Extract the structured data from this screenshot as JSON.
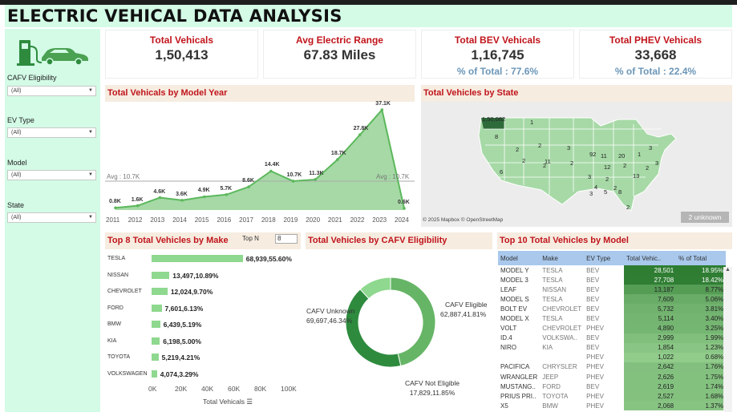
{
  "title": "ELECTRIC VEHICAL DATA ANALYSIS",
  "filters": [
    {
      "label": "CAFV Eligibility",
      "value": "(All)"
    },
    {
      "label": "EV Type",
      "value": "(All)"
    },
    {
      "label": "Model",
      "value": "(All)"
    },
    {
      "label": "State",
      "value": "(All)"
    }
  ],
  "kpis": {
    "total": {
      "title": "Total Vehicals",
      "value": "1,50,413"
    },
    "range": {
      "title": "Avg Electric Range",
      "value": "67.83 Miles"
    },
    "bev": {
      "title": "Total BEV Vehicals",
      "value": "1,16,745",
      "pct": "% of Total : 77.6%"
    },
    "phev": {
      "title": "Total PHEV Vehicals",
      "value": "33,668",
      "pct": "% of Total : 22.4%"
    }
  },
  "year_panel": {
    "title": "Total Vehicals by Model Year",
    "avg_left": "Avg : 10.7K",
    "avg_right": "Avg : 10.7K"
  },
  "state_panel": {
    "title": "Total Vehicles by State",
    "top_value": "1,50,082",
    "credit": "© 2025 Mapbox © OpenStreetMap",
    "unknown": "2 unknown"
  },
  "make_panel": {
    "title": "Top 8 Total Vehicles by Make",
    "topn_label": "Top N",
    "topn_value": "8",
    "xlabel": "Total Vehicals"
  },
  "cafv_panel": {
    "title": "Total Vehicles by CAFV Eligibility",
    "labels": [
      {
        "name": "CAFV Unknown",
        "value": "69,697,46.34%"
      },
      {
        "name": "CAFV Eligible",
        "value": "62,887,41.81%"
      },
      {
        "name": "CAFV Not Eligible",
        "value": "17,829,11.85%"
      }
    ]
  },
  "model_panel": {
    "title": "Top 10 Total Vehicles by Model",
    "headers": [
      "Model",
      "Make",
      "EV Type",
      "Total Vehic..",
      "% of Total"
    ],
    "rows": [
      [
        "MODEL Y",
        "TESLA",
        "BEV",
        "28,501",
        "18.95%"
      ],
      [
        "MODEL 3",
        "TESLA",
        "BEV",
        "27,708",
        "18.42%"
      ],
      [
        "LEAF",
        "NISSAN",
        "BEV",
        "13,187",
        "8.77%"
      ],
      [
        "MODEL S",
        "TESLA",
        "BEV",
        "7,609",
        "5.06%"
      ],
      [
        "BOLT EV",
        "CHEVROLET",
        "BEV",
        "5,732",
        "3.81%"
      ],
      [
        "MODEL X",
        "TESLA",
        "BEV",
        "5,114",
        "3.40%"
      ],
      [
        "VOLT",
        "CHEVROLET",
        "PHEV",
        "4,890",
        "3.25%"
      ],
      [
        "ID.4",
        "VOLKSWA..",
        "BEV",
        "2,999",
        "1.99%"
      ],
      [
        "NIRO",
        "KIA",
        "BEV",
        "1,854",
        "1.23%"
      ],
      [
        "",
        "",
        "PHEV",
        "1,022",
        "0.68%"
      ],
      [
        "PACIFICA",
        "CHRYSLER",
        "PHEV",
        "2,642",
        "1.76%"
      ],
      [
        "WRANGLER",
        "JEEP",
        "PHEV",
        "2,626",
        "1.75%"
      ],
      [
        "MUSTANG..",
        "FORD",
        "BEV",
        "2,619",
        "1.74%"
      ],
      [
        "PRIUS PRI..",
        "TOYOTA",
        "PHEV",
        "2,527",
        "1.68%"
      ],
      [
        "X5",
        "BMW",
        "PHEV",
        "2,068",
        "1.37%"
      ]
    ]
  },
  "colors": {
    "accent_red": "#c0141b",
    "green_dark": "#2e8b3e",
    "green_light": "#8fd88f",
    "header_bg": "#d3fbe6",
    "blue_pct": "#6b96b8"
  },
  "chart_data": [
    {
      "type": "area",
      "title": "Total Vehicals by Model Year",
      "categories": [
        "2011",
        "2012",
        "2013",
        "2014",
        "2015",
        "2016",
        "2017",
        "2018",
        "2019",
        "2020",
        "2021",
        "2022",
        "2023",
        "2024"
      ],
      "values": [
        0.8,
        1.6,
        4.6,
        3.6,
        4.9,
        5.7,
        8.6,
        14.4,
        10.7,
        11.3,
        18.7,
        27.8,
        37.1,
        0.6
      ],
      "labels": [
        "0.8K",
        "1.6K",
        "4.6K",
        "3.6K",
        "4.9K",
        "5.7K",
        "8.6K",
        "14.4K",
        "10.7K",
        "11.3K",
        "18.7K",
        "27.8K",
        "37.1K",
        "0.6K"
      ],
      "unit": "K",
      "reference_line": 10.7,
      "ylim": [
        0,
        38
      ]
    },
    {
      "type": "bar",
      "title": "Top 8 Total Vehicles by Make",
      "categories": [
        "TESLA",
        "NISSAN",
        "CHEVROLET",
        "FORD",
        "BMW",
        "KIA",
        "TOYOTA",
        "VOLKSWAGEN"
      ],
      "values": [
        68939,
        13497,
        12024,
        7601,
        6439,
        6198,
        5219,
        4074
      ],
      "labels": [
        "68,939,55.60%",
        "13,497,10.89%",
        "12,024,9.70%",
        "7,601,6.13%",
        "6,439,5.19%",
        "6,198,5.00%",
        "5,219,4.21%",
        "4,074,3.29%"
      ],
      "xticks": [
        "0K",
        "20K",
        "40K",
        "60K",
        "80K",
        "100K"
      ],
      "xlabel": "Total Vehicals",
      "xlim": [
        0,
        100000
      ]
    },
    {
      "type": "pie",
      "title": "Total Vehicles by CAFV Eligibility",
      "categories": [
        "CAFV Unknown",
        "CAFV Eligible",
        "CAFV Not Eligible"
      ],
      "values": [
        69697,
        62887,
        17829
      ],
      "percents": [
        46.34,
        41.81,
        11.85
      ],
      "colors": [
        "#66b566",
        "#2e8b3e",
        "#8fd88f"
      ]
    },
    {
      "type": "map",
      "title": "Total Vehicles by State",
      "values": [
        "1,50,082",
        "1",
        "8",
        "2",
        "2",
        "3",
        "2",
        "6",
        "2",
        "11",
        "2",
        "92",
        "11",
        "20",
        "1",
        "3",
        "12",
        "2",
        "3",
        "2",
        "4",
        "2",
        "13",
        "2",
        "3",
        "3",
        "5",
        "8",
        "2"
      ]
    }
  ]
}
